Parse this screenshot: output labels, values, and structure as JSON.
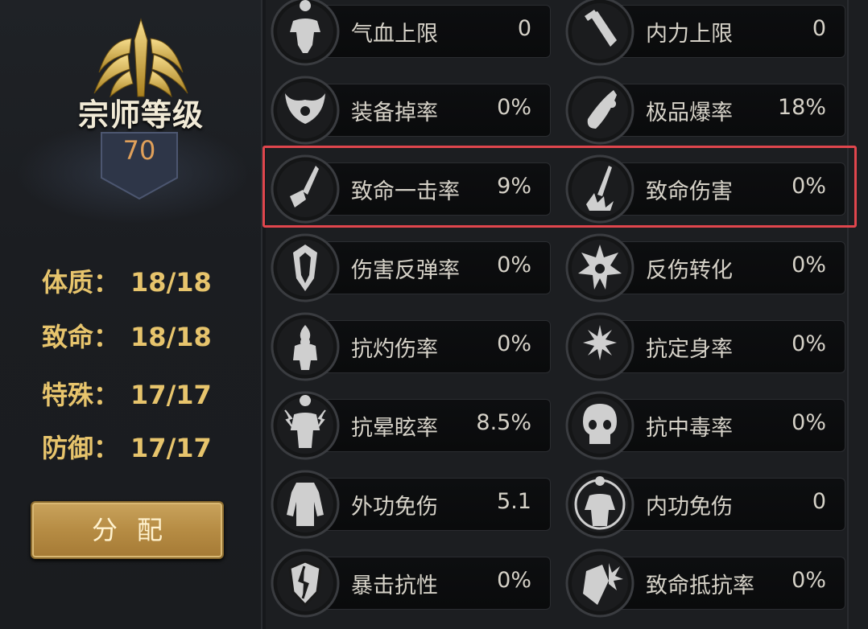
{
  "rank": {
    "title": "宗师等级",
    "level": "70"
  },
  "stats": [
    {
      "label": "体质",
      "sep": "：",
      "value": "18/18"
    },
    {
      "label": "致命",
      "sep": "：",
      "value": "18/18"
    },
    {
      "label": "特殊",
      "sep": "：",
      "value": "17/17"
    },
    {
      "label": "防御",
      "sep": "：",
      "value": "17/17"
    }
  ],
  "assign_button": "分配",
  "attributes": [
    {
      "label": "气血上限",
      "value": "0",
      "icon": "muscle-figure-icon"
    },
    {
      "label": "内力上限",
      "value": "0",
      "icon": "potion-vial-icon"
    },
    {
      "label": "装备掉率",
      "value": "0%",
      "icon": "winged-eye-icon"
    },
    {
      "label": "极品爆率",
      "value": "18%",
      "icon": "comet-burst-icon"
    },
    {
      "label": "致命一击率",
      "value": "9%",
      "icon": "sword-strike-icon"
    },
    {
      "label": "致命伤害",
      "value": "0%",
      "icon": "sword-splash-icon"
    },
    {
      "label": "伤害反弹率",
      "value": "0%",
      "icon": "reflect-shield-icon"
    },
    {
      "label": "反伤转化",
      "value": "0%",
      "icon": "spiky-eye-icon"
    },
    {
      "label": "抗灼伤率",
      "value": "0%",
      "icon": "flame-figure-icon"
    },
    {
      "label": "抗定身率",
      "value": "0%",
      "icon": "snowflake-hand-icon"
    },
    {
      "label": "抗晕眩率",
      "value": "8.5%",
      "icon": "lightning-figure-icon"
    },
    {
      "label": "抗中毒率",
      "value": "0%",
      "icon": "skull-icon"
    },
    {
      "label": "外功免伤",
      "value": "5.1",
      "icon": "armored-body-icon"
    },
    {
      "label": "内功免伤",
      "value": "0",
      "icon": "aura-figure-icon"
    },
    {
      "label": "暴击抗性",
      "value": "0%",
      "icon": "cracked-shield-icon"
    },
    {
      "label": "致命抵抗率",
      "value": "0%",
      "icon": "shield-burst-icon"
    }
  ],
  "colors": {
    "gold_text": "#e7c46c",
    "level_text": "#e0a05a",
    "highlight_border": "#e0464d",
    "button_gold": "#b68c44"
  }
}
